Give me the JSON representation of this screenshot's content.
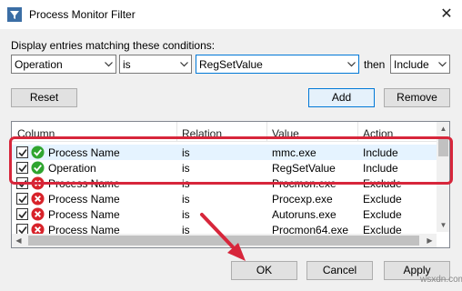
{
  "window": {
    "title": "Process Monitor Filter",
    "close_glyph": "✕"
  },
  "conditions": {
    "label": "Display entries matching these conditions:",
    "column_value": "Operation",
    "relation_value": "is",
    "value_value": "RegSetValue",
    "then_label": "then",
    "action_value": "Include"
  },
  "buttons": {
    "reset": "Reset",
    "add": "Add",
    "remove": "Remove",
    "ok": "OK",
    "cancel": "Cancel",
    "apply": "Apply"
  },
  "table": {
    "headers": [
      "Column",
      "Relation",
      "Value",
      "Action"
    ],
    "rows": [
      {
        "checked": true,
        "icon": "include-icon",
        "column": "Process Name",
        "relation": "is",
        "value": "mmc.exe",
        "action": "Include",
        "selected": true
      },
      {
        "checked": true,
        "icon": "include-icon",
        "column": "Operation",
        "relation": "is",
        "value": "RegSetValue",
        "action": "Include",
        "selected": false
      },
      {
        "checked": true,
        "icon": "exclude-icon",
        "column": "Process Name",
        "relation": "is",
        "value": "Procmon.exe",
        "action": "Exclude",
        "selected": false
      },
      {
        "checked": true,
        "icon": "exclude-icon",
        "column": "Process Name",
        "relation": "is",
        "value": "Procexp.exe",
        "action": "Exclude",
        "selected": false
      },
      {
        "checked": true,
        "icon": "exclude-icon",
        "column": "Process Name",
        "relation": "is",
        "value": "Autoruns.exe",
        "action": "Exclude",
        "selected": false
      },
      {
        "checked": true,
        "icon": "exclude-icon",
        "column": "Process Name",
        "relation": "is",
        "value": "Procmon64.exe",
        "action": "Exclude",
        "selected": false
      }
    ]
  },
  "watermark": "wsxdn.com",
  "colors": {
    "highlight": "#d7263b",
    "include": "#2fa52f",
    "exclude": "#d8232a",
    "accent": "#0078d7"
  }
}
